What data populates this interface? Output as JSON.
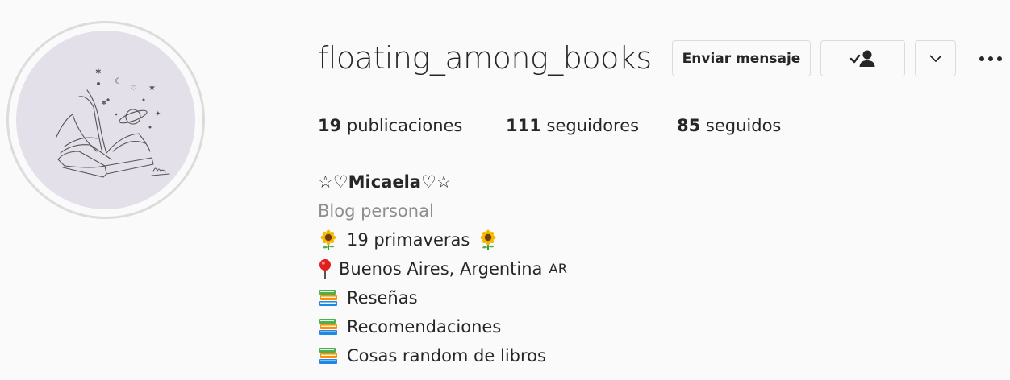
{
  "profile": {
    "username": "floating_among_books",
    "actions": {
      "message_label": "Enviar mensaje",
      "following_icon": "user-check-icon",
      "dropdown_icon": "chevron-down-icon",
      "more_icon": "more-horizontal-icon"
    },
    "stats": {
      "posts_count": "19",
      "posts_label": "publicaciones",
      "followers_count": "111",
      "followers_label": "seguidores",
      "following_count": "85",
      "following_label": "seguidos"
    },
    "bio": {
      "name": "☆♡Micaela♡☆",
      "category": "Blog personal",
      "lines": [
        {
          "emoji": "sunflower",
          "text": "19 primaveras",
          "trailing_emoji": "sunflower"
        },
        {
          "emoji": "round-pushpin",
          "text": "Buenos Aires, Argentina",
          "flag": "AR"
        },
        {
          "emoji": "books",
          "text": "Reseñas"
        },
        {
          "emoji": "books",
          "text": "Recomendaciones"
        },
        {
          "emoji": "books",
          "text": "Cosas random de libros"
        }
      ]
    }
  },
  "colors": {
    "background": "#fafafa",
    "avatar_bg": "#e3e0ea",
    "text": "#262626",
    "muted": "#8e8e8e",
    "border": "#dbdbdb"
  }
}
